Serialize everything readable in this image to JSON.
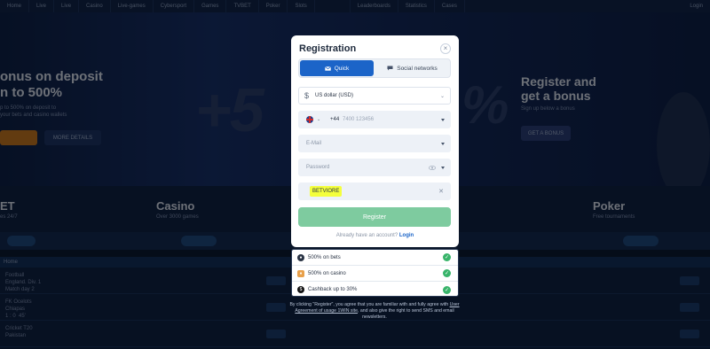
{
  "background": {
    "nav": [
      "Home",
      "Live",
      "Live",
      "Casino",
      "Live-games",
      "Cybersport",
      "Games",
      "TVBET",
      "Poker",
      "Slots",
      "",
      "Leaderboards",
      "Statistics",
      "Cases"
    ],
    "login_label": "Login",
    "hero_left_title": "onus on deposit\nn to 500%",
    "hero_left_sub": "p to 500% on deposit to\nyour bets and casino wallets",
    "hero_left_more": "MORE DETAILS",
    "hero_plus": "+5",
    "hero_pct": "%",
    "hero_right_title": "Register and\nget a bonus",
    "hero_right_sub": "Sign up below a bonus",
    "hero_right_btn": "GET A BONUS",
    "cat_left_title": "ET",
    "cat_left_sub": "es 24/7",
    "cat_casino_title": "Casino",
    "cat_casino_sub": "Over 3000 games",
    "cat_poker_title": "Poker",
    "cat_poker_sub": "Free tournaments",
    "table_head": "Home",
    "rows": [
      "Football\nEngland. Div. 1\nMatch day 2",
      "FK Ocelots\nChiapas\n1 : 0  45'",
      "Cricket T20\nPakistan"
    ]
  },
  "modal": {
    "title": "Registration",
    "close_symbol": "×",
    "tabs": [
      {
        "label": "Quick",
        "icon": "envelope-icon",
        "active": true
      },
      {
        "label": "Social networks",
        "icon": "chat-icon",
        "active": false
      }
    ],
    "currency_symbol": "$",
    "currency_value": "US dollar (USD)",
    "phone_code": "+44",
    "phone_placeholder": "7400 123456",
    "email_placeholder": "E-Mail",
    "password_placeholder": "Password",
    "promo_value": "BETVIORE",
    "register_label": "Register",
    "login_prompt": "Already have an account?",
    "login_link": "Login"
  },
  "bonuses": [
    {
      "label": "500% on bets",
      "icon": "soccer-ball-icon"
    },
    {
      "label": "500% on casino",
      "icon": "casino-icon"
    },
    {
      "label": "Cashback up to 30%",
      "icon": "cashback-icon"
    }
  ],
  "terms": {
    "part1": "By clicking \"Register\", you agree that you are familiar with and fully agree with ",
    "link": "User Agreement of usage 1WIN site",
    "part2": ", and also give the right to send SMS and email newsletters."
  },
  "colors": {
    "accent": "#1b64c8",
    "register": "#7ecb9f",
    "promo_highlight": "#f4ff3c",
    "check": "#38b46a"
  }
}
